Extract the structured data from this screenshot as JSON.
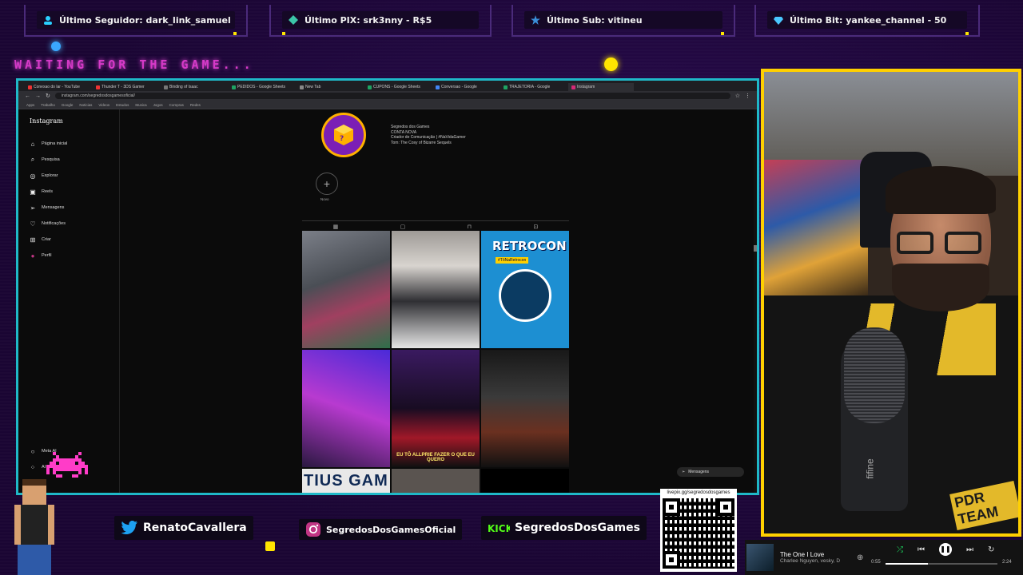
{
  "alerts": [
    {
      "label": "Último Seguidor: dark_link_samuel",
      "icon": "user-icon"
    },
    {
      "label": "Último PIX: srk3nny - R$5",
      "icon": "diamond-icon"
    },
    {
      "label": "Último Sub: vitineu",
      "icon": "star-icon"
    },
    {
      "label": "Último Bit: yankee_channel - 50",
      "icon": "gem-icon"
    }
  ],
  "overlay": {
    "waiting_text": "WAITING FOR THE GAME..."
  },
  "browser": {
    "tabs": [
      "Conexao do lar - YouTube",
      "Thunder T - 3DS Gamer",
      "Binding of Isaac",
      "PEDIDOS - Google Sheets",
      "New Tab",
      "CUPONS - Google Sheets",
      "Conversao - Google",
      "TRAJETORIA - Google",
      "Instagram"
    ],
    "url": "instagram.com/segredosdosgamesoficial/",
    "bookmarks": [
      "Apps",
      "Trabalho",
      "Google",
      "Noticias",
      "Videos",
      "Estudos",
      "Musica",
      "Jogos",
      "Compras",
      "Redes"
    ]
  },
  "instagram": {
    "logo": "Instagram",
    "nav": [
      {
        "label": "Página inicial",
        "icon": "home-icon"
      },
      {
        "label": "Pesquisa",
        "icon": "search-icon"
      },
      {
        "label": "Explorar",
        "icon": "compass-icon"
      },
      {
        "label": "Reels",
        "icon": "reels-icon"
      },
      {
        "label": "Mensagens",
        "icon": "messenger-icon"
      },
      {
        "label": "Notificações",
        "icon": "heart-icon"
      },
      {
        "label": "Criar",
        "icon": "plus-square-icon"
      },
      {
        "label": "Perfil",
        "icon": "profile-icon"
      }
    ],
    "bottom_nav": [
      {
        "label": "Meta AI",
        "icon": "meta-ai-icon"
      },
      {
        "label": "AI Studio",
        "icon": "ai-studio-icon"
      }
    ],
    "profile": {
      "name": "Segredos dos Games",
      "lines": [
        "CONTA NOVA",
        "Criador de Comunicação | #NaVidaGamer",
        "Tom: The Cosy of Bizarre Sequels"
      ]
    },
    "new_label": "Novo",
    "posts": [
      {
        "label": ""
      },
      {
        "label": ""
      },
      {
        "label": "RETROCON"
      },
      {
        "label": ""
      },
      {
        "label": "EU TÔ ALLPRIE FAZER O QUE EU QUERO"
      },
      {
        "label": ""
      },
      {
        "label": "TIUS GAM"
      },
      {
        "label": ""
      },
      {
        "label": ""
      }
    ],
    "messages_label": "Mensagens"
  },
  "socials": [
    {
      "label": "RenatoCavallera",
      "icon": "twitter-icon"
    },
    {
      "label": "SegredosDosGamesOficial",
      "icon": "instagram-icon"
    },
    {
      "label": "SegredosDosGames",
      "icon": "kick-icon"
    }
  ],
  "qr": {
    "label": "livepix.gg/segredosdosgames"
  },
  "player": {
    "title": "The One I Love",
    "artist": "Charlee Nguyen, vesky, D",
    "elapsed": "0:55",
    "duration": "2:24",
    "progress": 0.38
  },
  "webcam": {
    "mic_brand": "fifine",
    "shirt_text": "PDR TEAM"
  },
  "colors": {
    "accent_cyan": "#1fb8c8",
    "webcam_border": "#ffd000",
    "neon_pink": "#d63ac8"
  }
}
